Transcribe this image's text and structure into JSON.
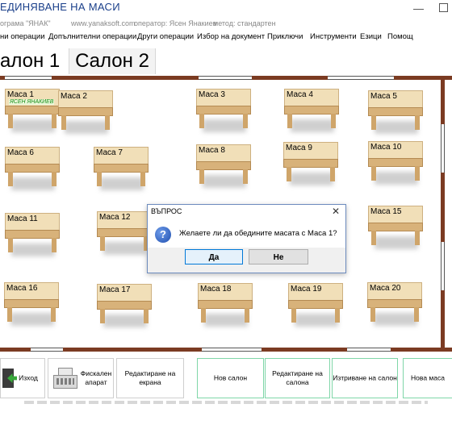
{
  "window": {
    "title": "ЕДИНЯВАНЕ НА МАСИ"
  },
  "info": {
    "program": "ограма \"ЯНАК\"",
    "site": "www.yanaksoft.com",
    "operator": "оператор: Ясен Янакиев",
    "method": "метод: стандартен"
  },
  "menu": [
    "ни операции",
    "Допълнителни операции",
    "Други операции",
    "Избор на документ",
    "Приключи",
    "Инструменти",
    "Езици",
    "Помощ"
  ],
  "tabs": [
    "алон 1",
    "Салон 2"
  ],
  "hall": {
    "tables": [
      {
        "label": "Маса 1",
        "occupant": "ЯСЕН ЯНАКИЕВ"
      },
      {
        "label": "Маса 2"
      },
      {
        "label": "Маса 3"
      },
      {
        "label": "Маса 4"
      },
      {
        "label": "Маса 5"
      },
      {
        "label": "Маса 6"
      },
      {
        "label": "Маса 7"
      },
      {
        "label": "Маса 8"
      },
      {
        "label": "Маса 9"
      },
      {
        "label": "Маса 10"
      },
      {
        "label": "Маса 11"
      },
      {
        "label": "Маса 12"
      },
      {
        "label": "Маса 15"
      },
      {
        "label": "Маса 16"
      },
      {
        "label": "Маса 17"
      },
      {
        "label": "Маса 18"
      },
      {
        "label": "Маса 19"
      },
      {
        "label": "Маса 20"
      }
    ]
  },
  "dialog": {
    "title": "ВЪПРОС",
    "message": "Желаете ли да обедините масата с Маса 1?",
    "yes": "Да",
    "no": "Не"
  },
  "toolbar": {
    "exit": "Изход",
    "fiscal": "Фискален апарат",
    "edit_screen": "Редактиране на екрана",
    "new_salon": "Нов салон",
    "edit_salon": "Редактиране на салона",
    "delete_salon": "Изтриване на салон",
    "new_table": "Нова маса"
  }
}
